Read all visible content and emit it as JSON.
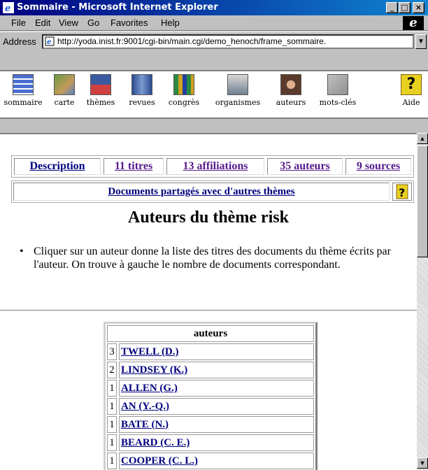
{
  "window": {
    "title": "Sommaire - Microsoft Internet Explorer",
    "minimize": "_",
    "maximize": "□",
    "close": "×"
  },
  "menu": [
    "File",
    "Edit",
    "View",
    "Go",
    "Favorites",
    "Help"
  ],
  "address": {
    "label": "Address",
    "url": "http://yoda.inist.fr:9001/cgi-bin/main.cgi/demo_henoch/frame_sommaire."
  },
  "toolbar": [
    {
      "label": "sommaire",
      "icon": "list-icon",
      "color": "#4a6fd0"
    },
    {
      "label": "carte",
      "icon": "map-icon",
      "color": "#c49a5a"
    },
    {
      "label": "thèmes",
      "icon": "themes-icon",
      "color": "#3a5aa0"
    },
    {
      "label": "revues",
      "icon": "journal-icon",
      "color": "#2a4a90"
    },
    {
      "label": "congrès",
      "icon": "conference-icon",
      "color": "#2a8a40"
    },
    {
      "label": "organismes",
      "icon": "organization-icon",
      "color": "#708090"
    },
    {
      "label": "auteurs",
      "icon": "author-icon",
      "color": "#5a3a2a"
    },
    {
      "label": "mots-clés",
      "icon": "keywords-icon",
      "color": "#909090"
    },
    {
      "label": "Aide",
      "icon": "help-icon",
      "color": "#e8d020"
    }
  ],
  "tabs": [
    "Description",
    "11 titres",
    "13 affiliations",
    "35 auteurs",
    "9 sources"
  ],
  "shared_link": "Documents partagés avec d'autres thèmes",
  "heading": "Auteurs du thème risk",
  "instruction": "Cliquer sur un auteur donne la liste des titres des documents du thème écrits par l'auteur. On trouve à gauche le nombre de documents correspondant.",
  "authors_table": {
    "header": "auteurs",
    "rows": [
      {
        "count": "3",
        "name": "TWELL (D.)"
      },
      {
        "count": "2",
        "name": "LINDSEY (K.)"
      },
      {
        "count": "1",
        "name": "ALLEN (G.)"
      },
      {
        "count": "1",
        "name": "AN (Y.-Q.)"
      },
      {
        "count": "1",
        "name": "BATE (N.)"
      },
      {
        "count": "1",
        "name": "BEARD (C. E.)"
      },
      {
        "count": "1",
        "name": "COOPER (C. L.)"
      }
    ]
  }
}
